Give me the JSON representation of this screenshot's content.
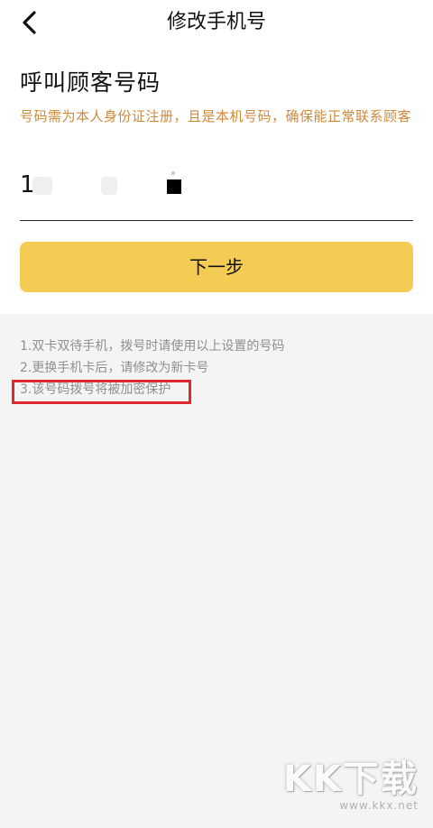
{
  "nav": {
    "title": "修改手机号"
  },
  "section": {
    "title": "呼叫顾客号码",
    "hint": "号码需为本人身份证注册，且是本机号码，确保能正常联系顾客"
  },
  "phone_input": {
    "value": "1"
  },
  "next_button": {
    "label": "下一步"
  },
  "notes": [
    "1.双卡双待手机，拨号时请使用以上设置的号码",
    "2.更换手机卡后，请修改为新卡号",
    "3.该号码拨号将被加密保护"
  ],
  "watermark": {
    "main": "KK下载",
    "sub": "www.kkx.net"
  },
  "icons": {
    "back": "chevron-left-icon"
  },
  "colors": {
    "accent_button": "#f4cb55",
    "hint_text": "#d08a3c",
    "highlight_border": "#e0272e",
    "background": "#f4f4f4"
  }
}
